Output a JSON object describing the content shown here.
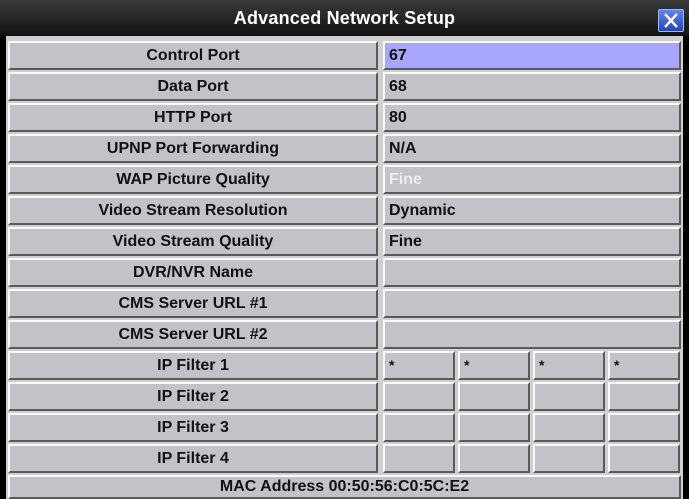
{
  "dialog": {
    "title": "Advanced Network Setup",
    "close_icon": "close-x-icon"
  },
  "rows": [
    {
      "id": "control-port",
      "label": "Control Port",
      "value": "67",
      "selected": true
    },
    {
      "id": "data-port",
      "label": "Data Port",
      "value": "68"
    },
    {
      "id": "http-port",
      "label": "HTTP Port",
      "value": "80"
    },
    {
      "id": "upnp-port-forwarding",
      "label": "UPNP Port Forwarding",
      "value": "N/A"
    },
    {
      "id": "wap-picture-quality",
      "label": "WAP Picture Quality",
      "value": "Fine",
      "disabled": true
    },
    {
      "id": "video-stream-resolution",
      "label": "Video Stream Resolution",
      "value": "Dynamic"
    },
    {
      "id": "video-stream-quality",
      "label": "Video Stream Quality",
      "value": "Fine"
    },
    {
      "id": "dvr-nvr-name",
      "label": "DVR/NVR Name",
      "value": ""
    },
    {
      "id": "cms-server-url-1",
      "label": "CMS Server URL #1",
      "value": ""
    },
    {
      "id": "cms-server-url-2",
      "label": "CMS Server URL #2",
      "value": ""
    }
  ],
  "ip_filters": [
    {
      "id": "ip-filter-1",
      "label": "IP Filter 1",
      "octets": [
        "*",
        "*",
        "*",
        "*"
      ]
    },
    {
      "id": "ip-filter-2",
      "label": "IP Filter 2",
      "octets": [
        "",
        "",
        "",
        ""
      ]
    },
    {
      "id": "ip-filter-3",
      "label": "IP Filter 3",
      "octets": [
        "",
        "",
        "",
        ""
      ]
    },
    {
      "id": "ip-filter-4",
      "label": "IP Filter 4",
      "octets": [
        "",
        "",
        "",
        ""
      ]
    }
  ],
  "footer": {
    "mac_text": "MAC Address 00:50:56:C0:5C:E2"
  },
  "colors": {
    "selected_value": "#a7a6fa",
    "cell_bg": "#c2c2c8",
    "disabled_text": "#eeeeee"
  }
}
